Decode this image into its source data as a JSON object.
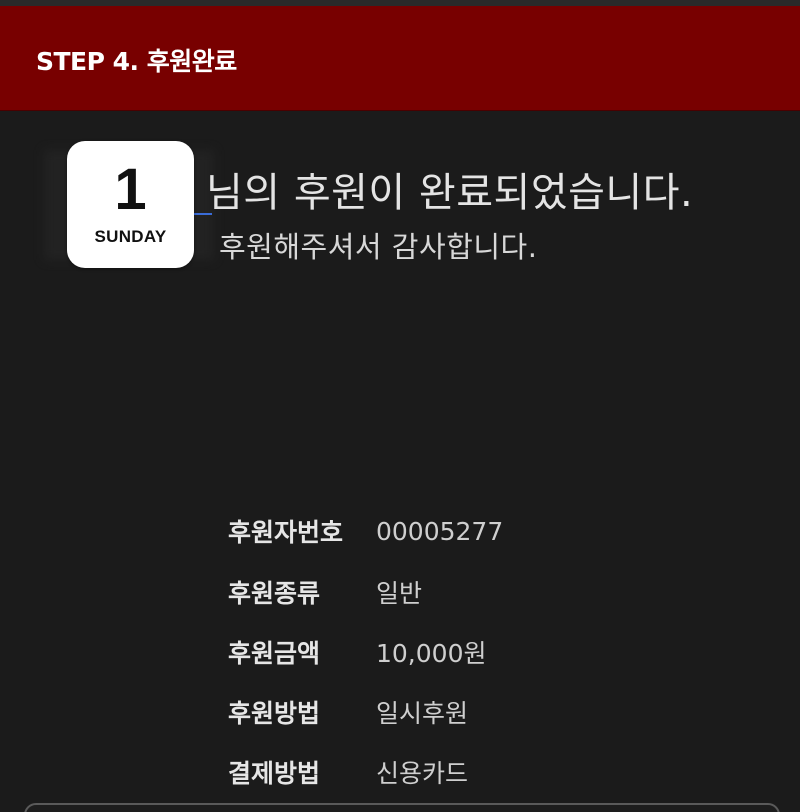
{
  "header": {
    "step_title": "STEP 4. 후원완료",
    "background_color": "#780000"
  },
  "calendar_badge": {
    "day": "1",
    "weekday": "SUNDAY"
  },
  "message": {
    "completion": "님의 후원이 완료되었습니다.",
    "thanks": "후원해주셔서 감사합니다."
  },
  "details": [
    {
      "label": "후원자번호",
      "value": "00005277"
    },
    {
      "label": "후원종류",
      "value": "일반"
    },
    {
      "label": "후원금액",
      "value": "10,000원"
    },
    {
      "label": "후원방법",
      "value": "일시후원"
    },
    {
      "label": "결제방법",
      "value": "신용카드"
    }
  ]
}
